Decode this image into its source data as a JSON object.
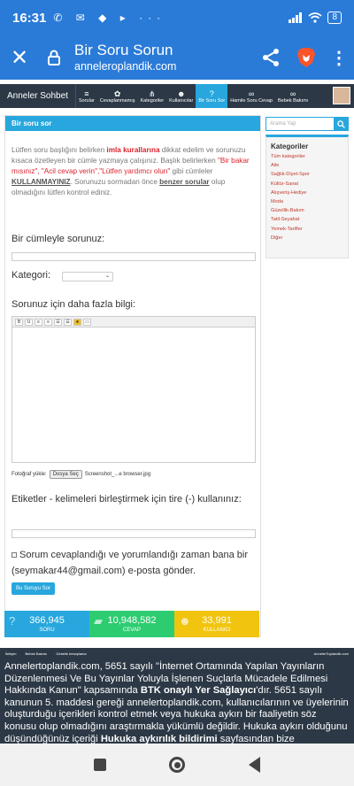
{
  "status": {
    "time": "16:31",
    "icons": "✆ ✉ ◆ ▸ ···",
    "battery": "8"
  },
  "browser": {
    "title": "Bir Soru Sorun",
    "url": "anneleroplandik.com"
  },
  "nav": {
    "brand": "Anneler Sohbet",
    "items": [
      {
        "icon": "≡",
        "label": "Sorular"
      },
      {
        "icon": "✿",
        "label": "Cevaplanmamış"
      },
      {
        "icon": "⋔",
        "label": "Kategoriler"
      },
      {
        "icon": "☻",
        "label": "Kullanıcılar"
      },
      {
        "icon": "?",
        "label": "Bir Soru Sor"
      },
      {
        "icon": "∞",
        "label": "Hamile Soru Cevap"
      },
      {
        "icon": "∞",
        "label": "Bebek Bakımı"
      }
    ]
  },
  "panel": {
    "header": "Bir soru sor",
    "intro": {
      "p1": "Lütfen soru başlığını belirken ",
      "red1": "imla kurallarına",
      "p2": " dikkat edelim ve sorunuzu kısaca özetleyen bir cümle yazmaya çalışınız. Başlık belirlerken ",
      "red2": "\"Bir bakar mısınız\", \"Acil cevap verin\",\"Lütfen yardımcı olun\"",
      "p3": " gibi cümleler ",
      "und1": "KULLANMAYINIZ",
      "p4": ". Sorunuzu sormadan önce ",
      "und2": "benzer sorular",
      "p5": " olup olmadığını lütfen kontrol ediniz."
    },
    "q_label": "Bir cümleyle sorunuz:",
    "cat_label": "Kategori:",
    "cat_value": "⌄",
    "more_label": "Sorunuz için daha fazla bilgi:",
    "toolbar": [
      "B",
      "U",
      "≡",
      "≡",
      "☰",
      "☰",
      "★",
      "▭"
    ],
    "photo_label": "Fotoğraf yükle:",
    "photo_btn": "Dosya Seç",
    "photo_file": "Screenshot_...e browser.jpg",
    "tags_label": "Etiketler - kelimeleri birleştirmek için tire (-) kullanınız:",
    "notify_label": "Sorum cevaplandığı ve yorumlandığı zaman bana bir (seymakar44@gmail.com) e-posta gönder.",
    "submit": "Bu Soruyu Sor"
  },
  "sidebar": {
    "search_placeholder": "Arama Yap",
    "cat_title": "Kategoriler",
    "categories": [
      "Tüm kategoriler",
      "Aile",
      "Sağlık-Diyet-Spor",
      "Kültür-Sanat",
      "Alışveriş-Hediye",
      "Moda",
      "Güzellik-Bakım",
      "Tatil-Seyahat",
      "Yemek-Tarifler",
      "Diğer"
    ]
  },
  "stats": [
    {
      "value": "366,945",
      "label": "SORU",
      "icon": "?",
      "color": "#27a7dd"
    },
    {
      "value": "10,948,582",
      "label": "CEVAP",
      "icon": "▰",
      "color": "#2ecc71"
    },
    {
      "value": "33,991",
      "label": "KULLANICI",
      "icon": "☻",
      "color": "#f1c40f"
    }
  ],
  "footbar": {
    "links": [
      "İletişim",
      "Bebek Bakımı",
      "Gebelik hesaplama"
    ],
    "brand": "AnnelerToplandik.com"
  },
  "footer": {
    "t1": "Annelertoplandik.com, 5651 sayılı \"İnternet Ortamında Yapılan Yayınların Düzenlenmesi Ve Bu Yayınlar Yoluyla İşlenen Suçlarla Mücadele Edilmesi Hakkında Kanun\" kapsamında ",
    "b1": "BTK onaylı Yer Sağlayıcı",
    "t2": "'dır. 5651 sayılı kanunun 5. maddesi gereği annelertoplandik.com, kullanıcılarının ve üyelerinin oluşturduğu içerikleri kontrol etmek veya hukuka aykırı bir faaliyetin söz konusu olup olmadığını araştırmakla yükümlü değildir. Hukuka aykırı olduğunu düşündüğünüz içeriği ",
    "b2": "Hukuka aykırılık bildirimi",
    "t3": " sayfasından bize bildirebilirsiniz."
  }
}
